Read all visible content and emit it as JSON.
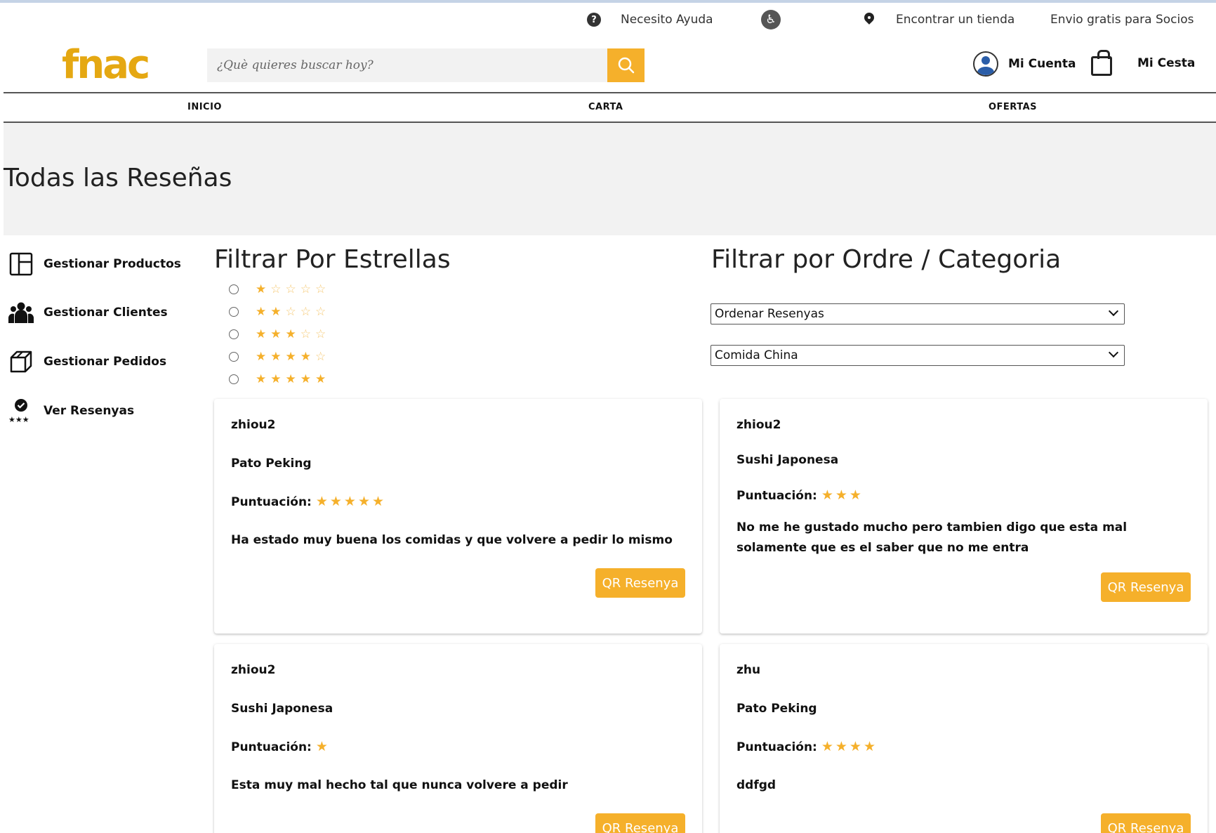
{
  "util": {
    "help": "Necesito Ayuda",
    "store": "Encontrar un tienda",
    "shipping": "Envio gratis para Socios"
  },
  "brand": {
    "logo": "fnac",
    "accent": "#f5b02b",
    "logo_color": "#e5a812"
  },
  "search": {
    "placeholder": "¿Què quieres buscar hoy?",
    "value": ""
  },
  "header": {
    "account": "Mi Cuenta",
    "cart": "Mi Cesta"
  },
  "nav": [
    "INICIO",
    "CARTA",
    "OFERTAS"
  ],
  "page_title": "Todas las Reseñas",
  "sidebar": [
    {
      "label": "Gestionar Productos",
      "icon": "layout-icon"
    },
    {
      "label": "Gestionar Clientes",
      "icon": "users-icon"
    },
    {
      "label": "Gestionar Pedidos",
      "icon": "box-icon"
    },
    {
      "label": "Ver Resenyas",
      "icon": "review-icon"
    }
  ],
  "star_filter": {
    "title": "Filtrar Por Estrellas",
    "options": [
      1,
      2,
      3,
      4,
      5
    ]
  },
  "order_filter": {
    "title": "Filtrar por Ordre / Categoria",
    "order_select": "Ordenar Resenyas",
    "category_select": "Comida China"
  },
  "reviews": [
    {
      "user": "zhiou2",
      "product": "Pato Peking",
      "score_label": "Puntuación:",
      "stars": "★★★★★",
      "rating": 5,
      "comment": "Ha estado muy buena los comidas y que volvere a pedir lo mismo",
      "button": "QR Resenya"
    },
    {
      "user": "zhiou2",
      "product": "Sushi Japonesa",
      "score_label": "Puntuación:",
      "stars": "★★★",
      "rating": 3,
      "comment": "No me he gustado mucho pero tambien digo que esta mal solamente que es el saber que no me entra",
      "button": "QR Resenya"
    },
    {
      "user": "zhiou2",
      "product": "Sushi Japonesa",
      "score_label": "Puntuación:",
      "stars": "★",
      "rating": 1,
      "comment": "Esta muy mal hecho tal que nunca volvere a pedir",
      "button": "QR Resenya"
    },
    {
      "user": "zhu",
      "product": "Pato Peking",
      "score_label": "Puntuación:",
      "stars": "★★★★",
      "rating": 4,
      "comment": "ddfgd",
      "button": "QR Resenya"
    }
  ]
}
